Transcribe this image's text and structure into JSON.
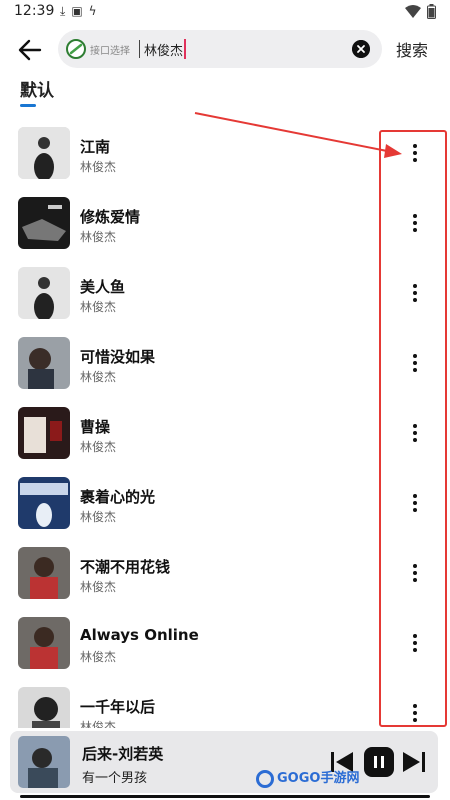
{
  "status_bar": {
    "time": "12:39",
    "icons": [
      "download-icon",
      "font-icon",
      "bolt-icon",
      "wifi-icon",
      "battery-icon"
    ]
  },
  "search": {
    "api_label": "接口选择",
    "query": "林俊杰",
    "search_button": "搜索"
  },
  "tabs": [
    {
      "label": "默认",
      "active": true
    }
  ],
  "songs": [
    {
      "title": "江南",
      "artist": "林俊杰",
      "cover_color": "#d8d8d8"
    },
    {
      "title": "修炼爱情",
      "artist": "林俊杰",
      "cover_color": "#222222"
    },
    {
      "title": "美人鱼",
      "artist": "林俊杰",
      "cover_color": "#d8d8d8"
    },
    {
      "title": "可惜没如果",
      "artist": "林俊杰",
      "cover_color": "#8a8f96"
    },
    {
      "title": "曹操",
      "artist": "林俊杰",
      "cover_color": "#2a1a1a"
    },
    {
      "title": "裹着心的光",
      "artist": "林俊杰",
      "cover_color": "#1f3a6b"
    },
    {
      "title": "不潮不用花钱",
      "artist": "林俊杰",
      "cover_color": "#7a5a4a"
    },
    {
      "title": "Always Online",
      "artist": "林俊杰",
      "cover_color": "#7a5a4a"
    },
    {
      "title": "一千年以后",
      "artist": "林俊杰",
      "cover_color": "#555555"
    }
  ],
  "now_playing": {
    "title": "后来-刘若英",
    "subtitle": "有一个男孩"
  },
  "watermark": "GOGO手游网",
  "colors": {
    "accent": "#1976d2",
    "highlight": "#e53935",
    "caret": "#e0315b"
  }
}
